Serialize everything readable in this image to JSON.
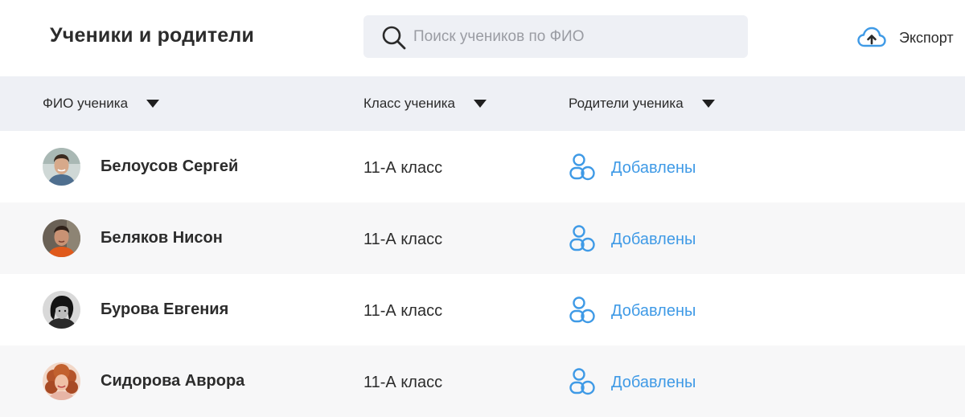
{
  "header": {
    "title": "Ученики и родители",
    "search_placeholder": "Поиск учеников по ФИО",
    "search_value": "",
    "export_label": "Экспорт"
  },
  "table": {
    "columns": [
      {
        "label": "ФИО ученика"
      },
      {
        "label": "Класс ученика"
      },
      {
        "label": "Родители ученика"
      }
    ],
    "rows": [
      {
        "name": "Белоусов Сергей",
        "class": "11-А класс",
        "parents": "Добавлены",
        "avatar": "man-smiling-avatar"
      },
      {
        "name": "Беляков Нисон",
        "class": "11-А класс",
        "parents": "Добавлены",
        "avatar": "man-orange-shirt-avatar"
      },
      {
        "name": "Бурова Евгения",
        "class": "11-А класс",
        "parents": "Добавлены",
        "avatar": "woman-bw-avatar"
      },
      {
        "name": "Сидорова Аврора",
        "class": "11-А класс",
        "parents": "Добавлены",
        "avatar": "woman-curly-hair-avatar"
      }
    ]
  },
  "colors": {
    "accent": "#3f9ae6",
    "header_bg": "#eef0f5",
    "row_alt_bg": "#f7f7f8",
    "text": "#2c2c2c"
  },
  "icons": {
    "search": "search-icon",
    "export": "cloud-upload-icon",
    "sort": "caret-down-icon",
    "parents": "parents-icon"
  }
}
